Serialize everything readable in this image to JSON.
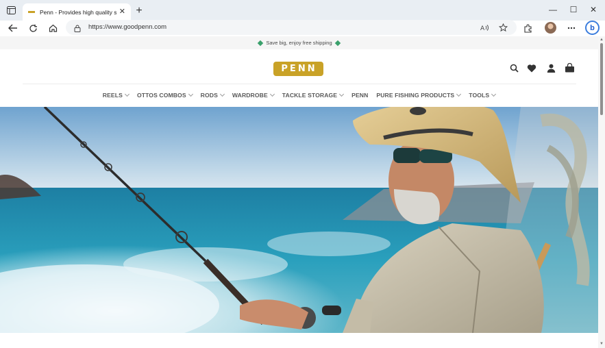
{
  "browser": {
    "tab_title": "Penn - Provides high quality salt",
    "tab_close": "✕",
    "new_tab": "+",
    "url": "https://www.goodpenn.com",
    "minimize": "—",
    "maximize": "☐",
    "close": "✕"
  },
  "site": {
    "promo_text": "Save big, enjoy free shipping",
    "logo_letters": [
      "P",
      "E",
      "N",
      "N"
    ],
    "brand_color": "#c9a227",
    "nav": [
      {
        "label": "REELS",
        "has_dropdown": true
      },
      {
        "label": "OTTOS COMBOS",
        "has_dropdown": true
      },
      {
        "label": "RODS",
        "has_dropdown": true
      },
      {
        "label": "WARDROBE",
        "has_dropdown": true
      },
      {
        "label": "TACKLE STORAGE",
        "has_dropdown": true
      },
      {
        "label": "PENN",
        "has_dropdown": false
      },
      {
        "label": "PURE FISHING PRODUCTS",
        "has_dropdown": true
      },
      {
        "label": "TOOLS",
        "has_dropdown": true
      }
    ],
    "header_icons": [
      "search-icon",
      "heart-icon",
      "account-icon",
      "cart-icon"
    ]
  }
}
